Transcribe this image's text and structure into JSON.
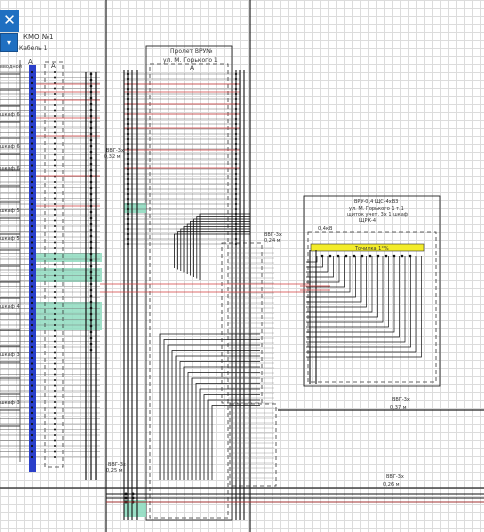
{
  "toolbar": {
    "close_glyph": "✕",
    "dropdown_glyph": "▾",
    "doc_tab": "КМО №1",
    "doc_subtitle": "Кабель 1"
  },
  "diagram": {
    "cabinet_main": {
      "title": "Пролет ВРУ№",
      "subtitle": "ул. М. Горького 1",
      "mark": "А"
    },
    "cabinet_right": {
      "title": "ВРУ-0,4 ЩС-4хВЗ",
      "address": "ул. М. Горького 1 т.1",
      "line2": "щиток учет. 3x 1 шкаф",
      "line3": "ЩРК-4",
      "label_top": "0,4кВ",
      "bus_label": "Точилка 1°%"
    },
    "col_left_mark": "А",
    "col_second_mark": "А",
    "cable_labels": [
      {
        "id": "c1",
        "text": "ВВГ-3x",
        "sub": "0,32 м"
      },
      {
        "id": "c2",
        "text": "ВВГ-3x",
        "sub": "0,24 м"
      },
      {
        "id": "c3",
        "text": "ВВГ-3x",
        "sub": "0,37 м"
      },
      {
        "id": "c4",
        "text": "ВВГ-3x",
        "sub": "0,26 м"
      },
      {
        "id": "c5",
        "text": "ВВГ-3x",
        "sub": "0,25 м"
      }
    ],
    "left_row_labels": [
      "вводной",
      "шкаф 6",
      "шкаф 6",
      "шкаф 6",
      "шкаф 5",
      "шкаф 5",
      "шкаф 4",
      "шкаф 3",
      "шкаф 3"
    ]
  },
  "colors": {
    "background": "#ffffff",
    "grid": "#dcdcdc",
    "wire": "#111111",
    "red_wire": "#d23b3b",
    "green_fill": "#8fdcc0",
    "blue_bus": "#2a3fc9",
    "yellow_bus": "#f3ec2a",
    "toolbar_blue": "#1f6fc1"
  }
}
